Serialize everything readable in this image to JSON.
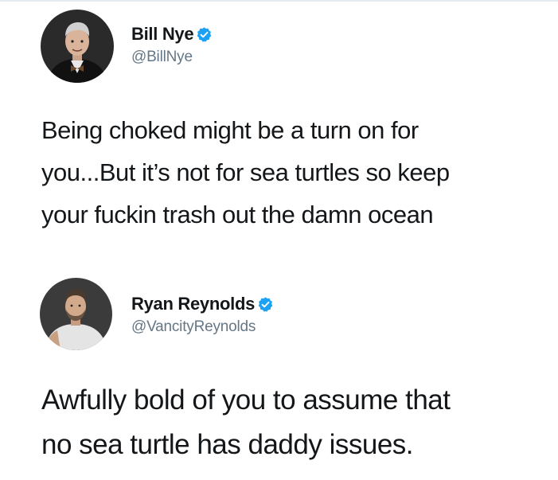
{
  "tweets": [
    {
      "display_name": "Bill Nye",
      "handle": "@BillNye",
      "verified": true,
      "avatar_icon": "avatar-photo-bill-nye",
      "text_lines": [
        "Being choked might be a turn on for",
        "you...But it’s not for sea turtles so keep",
        "your fuckin trash out the damn ocean"
      ]
    },
    {
      "display_name": "Ryan Reynolds",
      "handle": "@VancityReynolds",
      "verified": true,
      "avatar_icon": "avatar-photo-ryan-reynolds",
      "text_lines": [
        "Awfully bold of you to assume that",
        "no sea turtle has daddy issues."
      ]
    }
  ],
  "colors": {
    "verified_badge": "#1da1f2",
    "text": "#14171a",
    "handle": "#657786"
  }
}
